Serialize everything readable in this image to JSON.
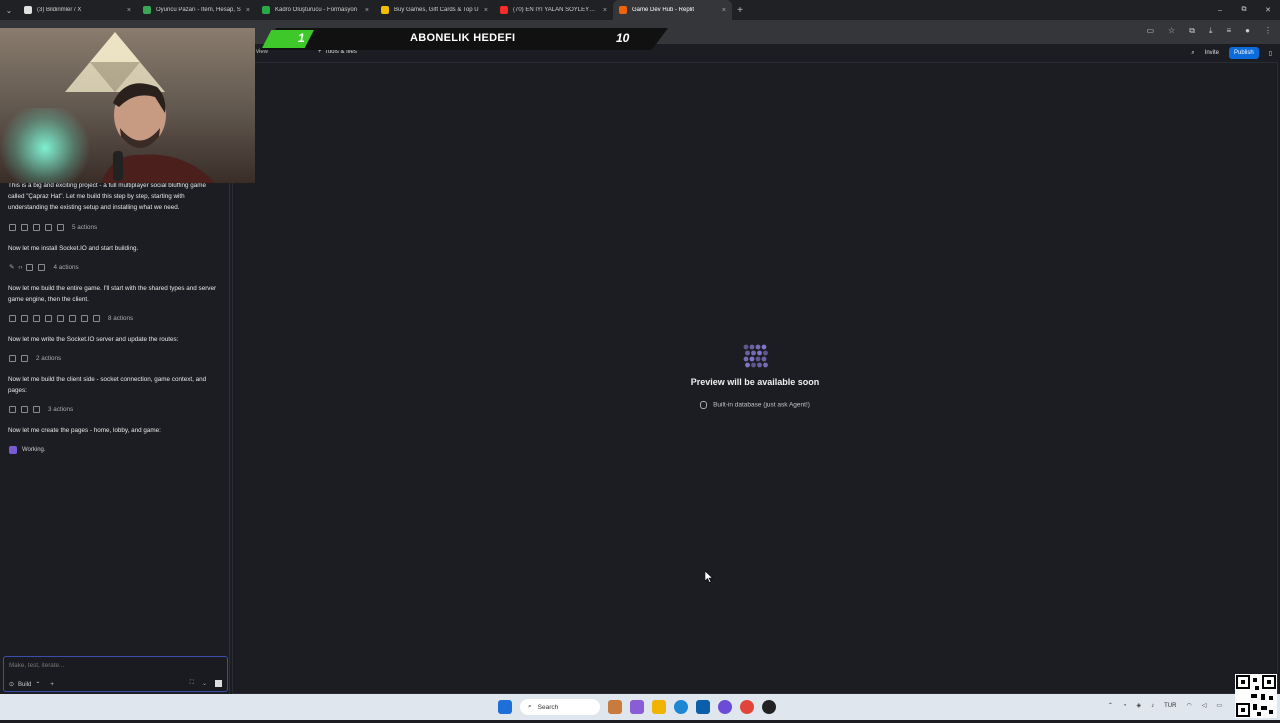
{
  "browser": {
    "tabs": [
      {
        "title": "(3) Bildirimler / X",
        "favicon_color": "#e0e0e0"
      },
      {
        "title": "Oyuncu Pazarı - İtem, Hesap, S",
        "favicon_color": "#3aa757"
      },
      {
        "title": "Kadro Oluşturucu - Formasyon",
        "favicon_color": "#29a847"
      },
      {
        "title": "Buy Games, Gift Cards & Top U",
        "favicon_color": "#f0c000"
      },
      {
        "title": "(70) EN İYİ YALAN SÖYLEYEN O",
        "favicon_color": "#ff2a2a"
      },
      {
        "title": "Game Dev Hub - Replit",
        "favicon_color": "#f26207"
      }
    ],
    "active_tab_index": 5,
    "close_glyph": "×",
    "new_tab_glyph": "+",
    "window_controls": [
      "–",
      "⧉",
      "✕"
    ]
  },
  "overlay": {
    "current": "1",
    "label": "ABONELIK HEDEFI",
    "goal": "10"
  },
  "app_header": {
    "preview_tab": "view",
    "tools_label": "Tools & files",
    "invite_label": "Invite",
    "publish_label": "Publish"
  },
  "chat": {
    "messages": [
      {
        "text": "This is a big and exciting project - a full multiplayer social bluffing game called \"Çapraz Hat\". Let me build this step by step, starting with understanding the existing setup and installing what we need.",
        "actions": "5 actions"
      },
      {
        "text": "Now let me install Socket.IO and start building.",
        "actions": "4 actions"
      },
      {
        "text": "Now let me build the entire game. I'll start with the shared types and server game engine, then the client.",
        "actions": "8 actions"
      },
      {
        "text": "Now let me write the Socket.IO server and update the routes:",
        "actions": "2 actions"
      },
      {
        "text": "Now let me build the client side - socket connection, game context, and pages:",
        "actions": "3 actions"
      },
      {
        "text": "Now let me create the pages - home, lobby, and game:",
        "actions": ""
      }
    ],
    "status": "Working.",
    "composer_placeholder": "Make, test, iterate...",
    "mode_label": "Build"
  },
  "preview": {
    "title": "Preview will be available soon",
    "db_note": "Built-in database (just ask Agent!)",
    "logo_color": "#8b7fd8"
  },
  "taskbar": {
    "search_label": "Search",
    "language": "TUR"
  }
}
